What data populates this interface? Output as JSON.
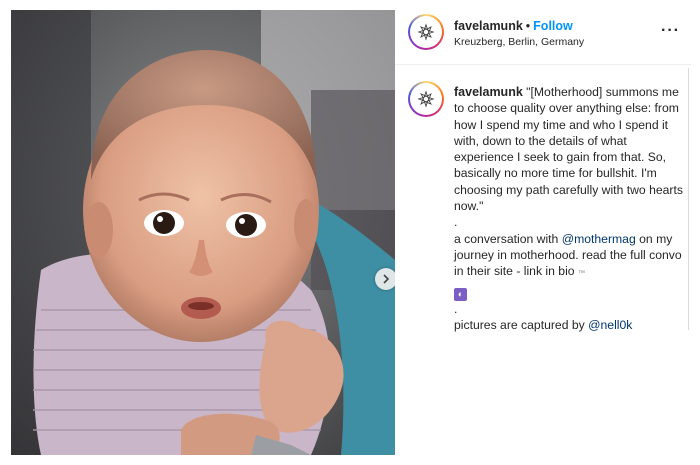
{
  "post": {
    "username": "favelamunk",
    "follow_label": "Follow",
    "location": "Kreuzberg, Berlin, Germany",
    "more_icon": "more-horizontal-icon",
    "next_icon": "chevron-right-icon"
  },
  "caption": {
    "username": "favelamunk",
    "quote": "\"[Motherhood] summons me to choose quality over anything else: from how I spend my time and who I spend it with, down to the details of what experience I seek to gain from that. So, basically no more time for bullshit. I'm choosing my path carefully with two hearts now.\"",
    "dot1": ".",
    "line2_pre": "a conversation with ",
    "mention1": "@mothermag",
    "line2_post": " on my journey in motherhood. read the full convo in their site - link in bio",
    "tm": "™",
    "dot2": ".",
    "line3_pre": "pictures are captured by ",
    "mention2": "@nell0k"
  },
  "colors": {
    "link": "#0095f6",
    "mention": "#00376b",
    "text": "#262626"
  }
}
